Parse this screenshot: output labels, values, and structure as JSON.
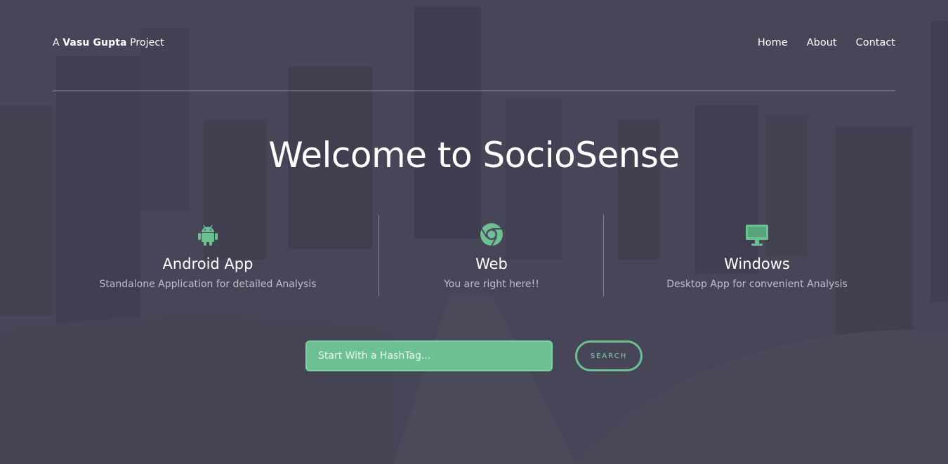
{
  "header": {
    "brand_prefix": "A",
    "brand_name": "Vasu Gupta",
    "brand_suffix": "Project",
    "nav": [
      {
        "label": "Home"
      },
      {
        "label": "About"
      },
      {
        "label": "Contact"
      }
    ]
  },
  "hero": {
    "title": "Welcome to SocioSense"
  },
  "features": [
    {
      "icon": "android-icon",
      "title": "Android App",
      "description": "Standalone Application for detailed Analysis"
    },
    {
      "icon": "chrome-icon",
      "title": "Web",
      "description": "You are right here!!"
    },
    {
      "icon": "desktop-icon",
      "title": "Windows",
      "description": "Desktop App for convenient Analysis"
    }
  ],
  "search": {
    "placeholder": "Start With a HashTag...",
    "button_label": "SEARCH"
  },
  "colors": {
    "accent": "#6cc092",
    "overlay": "#4b4b5f"
  }
}
